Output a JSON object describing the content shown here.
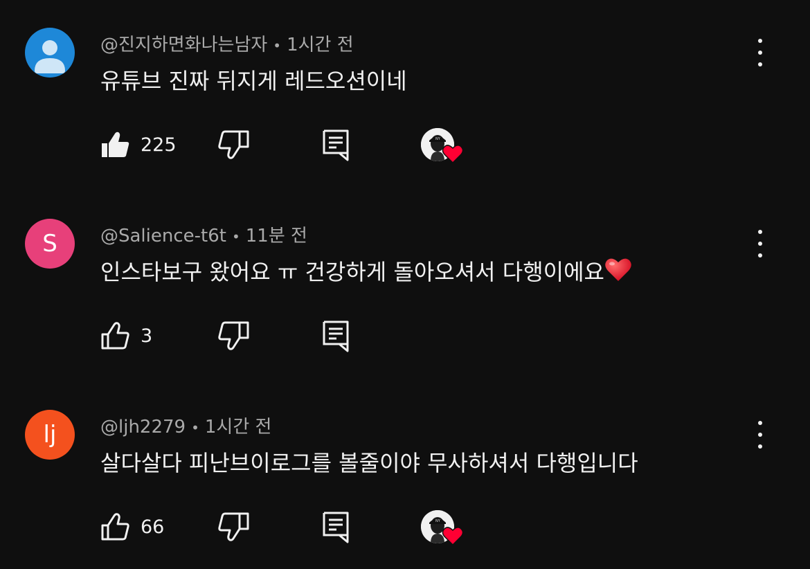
{
  "comments": [
    {
      "author": "@진지하면화나는남자",
      "time": "1시간 전",
      "avatar_letter": "",
      "avatar_type": "default-person",
      "avatar_color": "#1e88d8",
      "text": "유튜브 진짜 뒤지게 레드오션이네",
      "likes": "225",
      "liked": true,
      "creator_heart": true
    },
    {
      "author": "@Salience-t6t",
      "time": "11분 전",
      "avatar_letter": "S",
      "avatar_type": "letter",
      "avatar_color": "#e7407a",
      "text": "인스타보구 왔어요 ㅠ 건강하게 돌아오셔서 다행이에요",
      "text_emoji": "heart-emoji",
      "likes": "3",
      "liked": false,
      "creator_heart": false
    },
    {
      "author": "@ljh2279",
      "time": "1시간 전",
      "avatar_letter": "lj",
      "avatar_type": "letter",
      "avatar_color": "#f4511e",
      "text": "살다살다 피난브이로그를 볼줄이야 무사하셔서 다행입니다",
      "likes": "66",
      "liked": false,
      "creator_heart": true
    }
  ],
  "separator": "•",
  "icons": {
    "like": "thumbs-up-icon",
    "dislike": "thumbs-down-icon",
    "reply": "reply-comment-icon",
    "menu": "more-vert-icon",
    "heart": "creator-heart-icon"
  },
  "colors": {
    "background": "#0f0f0f",
    "text": "#f1f1f1",
    "meta": "#aaaaaa",
    "heart": "#ff0033"
  }
}
